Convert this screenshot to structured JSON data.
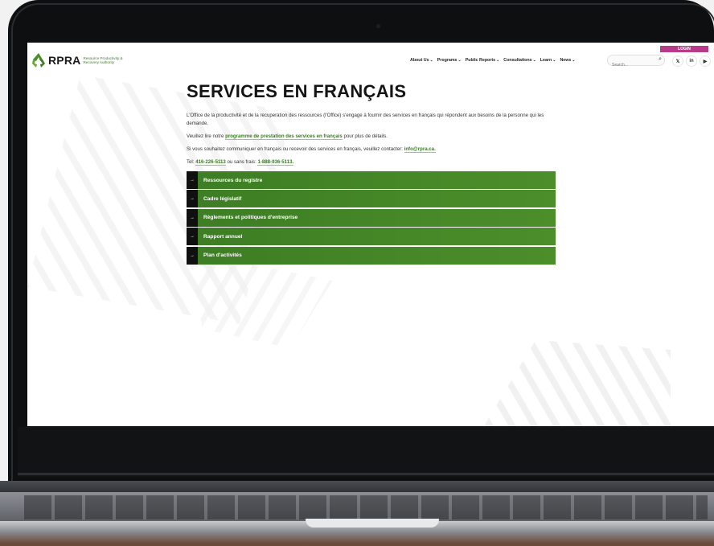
{
  "header": {
    "logo_text": "RPRA",
    "logo_tagline": "Resource Productivity & Recovery Authority",
    "login_label": "LOGIN",
    "nav": [
      {
        "label": "About Us"
      },
      {
        "label": "Programs"
      },
      {
        "label": "Public Reports"
      },
      {
        "label": "Consultations"
      },
      {
        "label": "Learn"
      },
      {
        "label": "News"
      }
    ],
    "search_placeholder": "Search..."
  },
  "social": {
    "x": "𝕏",
    "linkedin": "in",
    "youtube": "▶"
  },
  "main": {
    "title": "SERVICES EN FRANÇAIS",
    "intro": "L'Office de la productivité et de la recuperation des ressources (l'Office) s'engage à fournir des services en français qui répondent aux besoins de la personne qui les demande.",
    "read_prefix": "Veuillez lire notre",
    "read_link": "programme de prestation des services en français",
    "read_suffix": "pour plus de détails.",
    "contact_prefix": "Si vous souhaitez communiquer en français ou recevoir des services en français, veuillez contacter:",
    "contact_email": "info@rpra.ca.",
    "tel_prefix": "Tel:",
    "tel_number": "416-226-5113",
    "tel_middle": "ou sans frais:",
    "tel_tollfree": "1-888-936-5113."
  },
  "menu_items": [
    {
      "label": "Ressources du registre"
    },
    {
      "label": "Cadre législatif"
    },
    {
      "label": "Règlements et politiques d'entreprise"
    },
    {
      "label": "Rapport annuel"
    },
    {
      "label": "Plan d'activités"
    }
  ],
  "colors": {
    "accent_green": "#3d7d24",
    "login_magenta": "#b83b8b"
  }
}
